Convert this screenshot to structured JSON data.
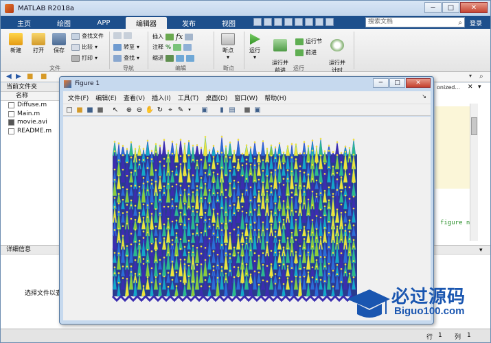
{
  "app": {
    "title": "MATLAB R2018a"
  },
  "tabs": [
    {
      "label": "主页"
    },
    {
      "label": "绘图"
    },
    {
      "label": "APP"
    },
    {
      "label": "编辑器"
    },
    {
      "label": "发布"
    },
    {
      "label": "视图"
    }
  ],
  "search": {
    "placeholder": "搜索文档"
  },
  "login_label": "登录",
  "ribbon": {
    "file_group": {
      "new": "新建",
      "open": "打开",
      "save": "保存",
      "find_files": "查找文件",
      "compare": "比较",
      "print": "打印",
      "label": "文件"
    },
    "nav_group": {
      "goto": "转至",
      "find": "查找",
      "label": "导航"
    },
    "edit_group": {
      "insert": "插入",
      "comment": "注释",
      "indent": "缩进",
      "label": "编辑"
    },
    "breakpoint_group": {
      "breakpoints": "断点",
      "label": "断点"
    },
    "run_group": {
      "run": "运行",
      "run_and_advance": "运行并\n前进",
      "run_section": "运行节",
      "advance": "前进",
      "run_and_time": "运行并\n计时",
      "label": "运行"
    }
  },
  "file_pane": {
    "title": "当前文件夹",
    "column_name": "名称",
    "files": [
      {
        "name": "Diffuse.m"
      },
      {
        "name": "Main.m"
      },
      {
        "name": "movie.avi"
      },
      {
        "name": "README.m"
      }
    ]
  },
  "detail_pane": {
    "title": "详细信息",
    "hint": "选择文件以查"
  },
  "editor": {
    "tab_text": "onized...",
    "code_snippet": "figure n"
  },
  "status": {
    "row_label": "行",
    "row_value": "1",
    "col_label": "列",
    "col_value": "1"
  },
  "figure": {
    "title": "Figure 1",
    "menus": [
      {
        "label": "文件(F)"
      },
      {
        "label": "编辑(E)"
      },
      {
        "label": "查看(V)"
      },
      {
        "label": "插入(I)"
      },
      {
        "label": "工具(T)"
      },
      {
        "label": "桌面(D)"
      },
      {
        "label": "窗口(W)"
      },
      {
        "label": "帮助(H)"
      }
    ],
    "colormap": [
      "#3b2db0",
      "#2a6fd6",
      "#13a8c8",
      "#2cbb8a",
      "#8fcb3a",
      "#f2e13c"
    ]
  },
  "watermark": {
    "brand": "必过源码",
    "url": "Biguo100.com"
  }
}
